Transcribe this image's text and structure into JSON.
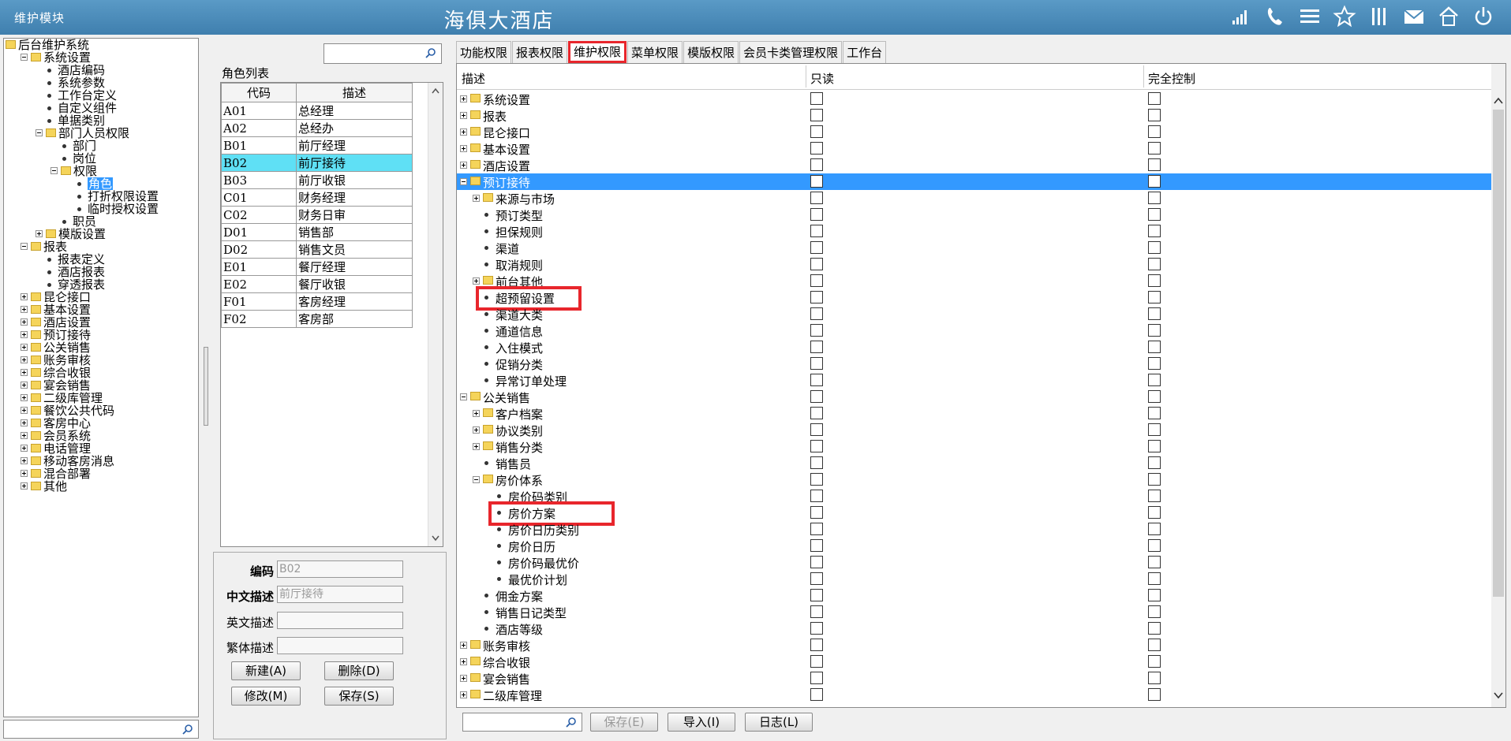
{
  "header": {
    "module_title": "维护模块",
    "hotel_name": "海俱大酒店",
    "icons": [
      "signal-icon",
      "phone-icon",
      "menu-icon",
      "star-icon",
      "columns-icon",
      "mail-icon",
      "home-settings-icon",
      "power-icon"
    ]
  },
  "left_tree": {
    "items": [
      {
        "label": "后台维护系统",
        "level": 0,
        "type": "folder",
        "expander": "none"
      },
      {
        "label": "系统设置",
        "level": 1,
        "type": "folder",
        "expander": "minus"
      },
      {
        "label": "酒店编码",
        "level": 2,
        "type": "leaf"
      },
      {
        "label": "系统参数",
        "level": 2,
        "type": "leaf"
      },
      {
        "label": "工作台定义",
        "level": 2,
        "type": "leaf"
      },
      {
        "label": "自定义组件",
        "level": 2,
        "type": "leaf"
      },
      {
        "label": "单据类别",
        "level": 2,
        "type": "leaf"
      },
      {
        "label": "部门人员权限",
        "level": 2,
        "type": "folder",
        "expander": "minus"
      },
      {
        "label": "部门",
        "level": 3,
        "type": "leaf"
      },
      {
        "label": "岗位",
        "level": 3,
        "type": "leaf"
      },
      {
        "label": "权限",
        "level": 3,
        "type": "folder",
        "expander": "minus"
      },
      {
        "label": "角色",
        "level": 4,
        "type": "leaf",
        "selected": true
      },
      {
        "label": "打折权限设置",
        "level": 4,
        "type": "leaf"
      },
      {
        "label": "临时授权设置",
        "level": 4,
        "type": "leaf"
      },
      {
        "label": "职员",
        "level": 3,
        "type": "leaf"
      },
      {
        "label": "模版设置",
        "level": 2,
        "type": "folder",
        "expander": "plus"
      },
      {
        "label": "报表",
        "level": 1,
        "type": "folder",
        "expander": "minus"
      },
      {
        "label": "报表定义",
        "level": 2,
        "type": "leaf"
      },
      {
        "label": "酒店报表",
        "level": 2,
        "type": "leaf"
      },
      {
        "label": "穿透报表",
        "level": 2,
        "type": "leaf"
      },
      {
        "label": "昆仑接口",
        "level": 1,
        "type": "folder",
        "expander": "plus"
      },
      {
        "label": "基本设置",
        "level": 1,
        "type": "folder",
        "expander": "plus"
      },
      {
        "label": "酒店设置",
        "level": 1,
        "type": "folder",
        "expander": "plus"
      },
      {
        "label": "预订接待",
        "level": 1,
        "type": "folder",
        "expander": "plus"
      },
      {
        "label": "公关销售",
        "level": 1,
        "type": "folder",
        "expander": "plus"
      },
      {
        "label": "账务审核",
        "level": 1,
        "type": "folder",
        "expander": "plus"
      },
      {
        "label": "综合收银",
        "level": 1,
        "type": "folder",
        "expander": "plus"
      },
      {
        "label": "宴会销售",
        "level": 1,
        "type": "folder",
        "expander": "plus"
      },
      {
        "label": "二级库管理",
        "level": 1,
        "type": "folder",
        "expander": "plus"
      },
      {
        "label": "餐饮公共代码",
        "level": 1,
        "type": "folder",
        "expander": "plus"
      },
      {
        "label": "客房中心",
        "level": 1,
        "type": "folder",
        "expander": "plus"
      },
      {
        "label": "会员系统",
        "level": 1,
        "type": "folder",
        "expander": "plus"
      },
      {
        "label": "电话管理",
        "level": 1,
        "type": "folder",
        "expander": "plus"
      },
      {
        "label": "移动客房消息",
        "level": 1,
        "type": "folder",
        "expander": "plus"
      },
      {
        "label": "混合部署",
        "level": 1,
        "type": "folder",
        "expander": "plus"
      },
      {
        "label": "其他",
        "level": 1,
        "type": "folder",
        "expander": "plus"
      }
    ]
  },
  "role_list": {
    "group_label": "角色列表",
    "columns": [
      "代码",
      "描述"
    ],
    "rows": [
      {
        "code": "A01",
        "desc": "总经理"
      },
      {
        "code": "A02",
        "desc": "总经办"
      },
      {
        "code": "B01",
        "desc": "前厅经理"
      },
      {
        "code": "B02",
        "desc": "前厅接待",
        "selected": true
      },
      {
        "code": "B03",
        "desc": "前厅收银"
      },
      {
        "code": "C01",
        "desc": "财务经理"
      },
      {
        "code": "C02",
        "desc": "财务日审"
      },
      {
        "code": "D01",
        "desc": "销售部"
      },
      {
        "code": "D02",
        "desc": "销售文员"
      },
      {
        "code": "E01",
        "desc": "餐厅经理"
      },
      {
        "code": "E02",
        "desc": "餐厅收银"
      },
      {
        "code": "F01",
        "desc": "客房经理"
      },
      {
        "code": "F02",
        "desc": "客房部"
      }
    ]
  },
  "role_form": {
    "code_label": "编码",
    "code_value": "B02",
    "cn_label": "中文描述",
    "cn_value": "前厅接待",
    "en_label": "英文描述",
    "en_value": "",
    "tw_label": "繁体描述",
    "tw_value": "",
    "new_btn": "新建(A)",
    "delete_btn": "删除(D)",
    "edit_btn": "修改(M)",
    "save_btn": "保存(S)"
  },
  "tabs": [
    "功能权限",
    "报表权限",
    "维护权限",
    "菜单权限",
    "模版权限",
    "会员卡类管理权限",
    "工作台"
  ],
  "active_tab": 2,
  "permissions": {
    "columns": [
      "描述",
      "只读",
      "完全控制"
    ],
    "rows": [
      {
        "label": "系统设置",
        "level": 0,
        "type": "folder",
        "expander": "plus"
      },
      {
        "label": "报表",
        "level": 0,
        "type": "folder",
        "expander": "plus"
      },
      {
        "label": "昆仑接口",
        "level": 0,
        "type": "folder",
        "expander": "plus"
      },
      {
        "label": "基本设置",
        "level": 0,
        "type": "folder",
        "expander": "plus"
      },
      {
        "label": "酒店设置",
        "level": 0,
        "type": "folder",
        "expander": "plus"
      },
      {
        "label": "预订接待",
        "level": 0,
        "type": "folder",
        "expander": "minus",
        "selected": true
      },
      {
        "label": "来源与市场",
        "level": 1,
        "type": "folder",
        "expander": "plus"
      },
      {
        "label": "预订类型",
        "level": 1,
        "type": "leaf"
      },
      {
        "label": "担保规则",
        "level": 1,
        "type": "leaf"
      },
      {
        "label": "渠道",
        "level": 1,
        "type": "leaf"
      },
      {
        "label": "取消规则",
        "level": 1,
        "type": "leaf"
      },
      {
        "label": "前台其他",
        "level": 1,
        "type": "folder",
        "expander": "plus"
      },
      {
        "label": "超预留设置",
        "level": 1,
        "type": "leaf",
        "highlight": true
      },
      {
        "label": "渠道大类",
        "level": 1,
        "type": "leaf"
      },
      {
        "label": "通道信息",
        "level": 1,
        "type": "leaf"
      },
      {
        "label": "入住模式",
        "level": 1,
        "type": "leaf"
      },
      {
        "label": "促销分类",
        "level": 1,
        "type": "leaf"
      },
      {
        "label": "异常订单处理",
        "level": 1,
        "type": "leaf"
      },
      {
        "label": "公关销售",
        "level": 0,
        "type": "folder",
        "expander": "minus"
      },
      {
        "label": "客户档案",
        "level": 1,
        "type": "folder",
        "expander": "plus"
      },
      {
        "label": "协议类别",
        "level": 1,
        "type": "folder",
        "expander": "plus"
      },
      {
        "label": "销售分类",
        "level": 1,
        "type": "folder",
        "expander": "plus"
      },
      {
        "label": "销售员",
        "level": 1,
        "type": "leaf"
      },
      {
        "label": "房价体系",
        "level": 1,
        "type": "folder",
        "expander": "minus"
      },
      {
        "label": "房价码类别",
        "level": 2,
        "type": "leaf"
      },
      {
        "label": "房价方案",
        "level": 2,
        "type": "leaf",
        "highlight": true
      },
      {
        "label": "房价日历类别",
        "level": 2,
        "type": "leaf"
      },
      {
        "label": "房价日历",
        "level": 2,
        "type": "leaf"
      },
      {
        "label": "房价码最优价",
        "level": 2,
        "type": "leaf"
      },
      {
        "label": "最优价计划",
        "level": 2,
        "type": "leaf"
      },
      {
        "label": "佣金方案",
        "level": 1,
        "type": "leaf"
      },
      {
        "label": "销售日记类型",
        "level": 1,
        "type": "leaf"
      },
      {
        "label": "酒店等级",
        "level": 1,
        "type": "leaf"
      },
      {
        "label": "账务审核",
        "level": 0,
        "type": "folder",
        "expander": "plus"
      },
      {
        "label": "综合收银",
        "level": 0,
        "type": "folder",
        "expander": "plus"
      },
      {
        "label": "宴会销售",
        "level": 0,
        "type": "folder",
        "expander": "plus"
      },
      {
        "label": "二级库管理",
        "level": 0,
        "type": "folder",
        "expander": "plus"
      }
    ]
  },
  "bottom_bar": {
    "save_btn": "保存(E)",
    "import_btn": "导入(I)",
    "log_btn": "日志(L)"
  },
  "colors": {
    "title_bar": "#4a8bba",
    "selection": "#3399ff",
    "role_selection": "#5fe0f5",
    "highlight_box": "#e8262c"
  }
}
